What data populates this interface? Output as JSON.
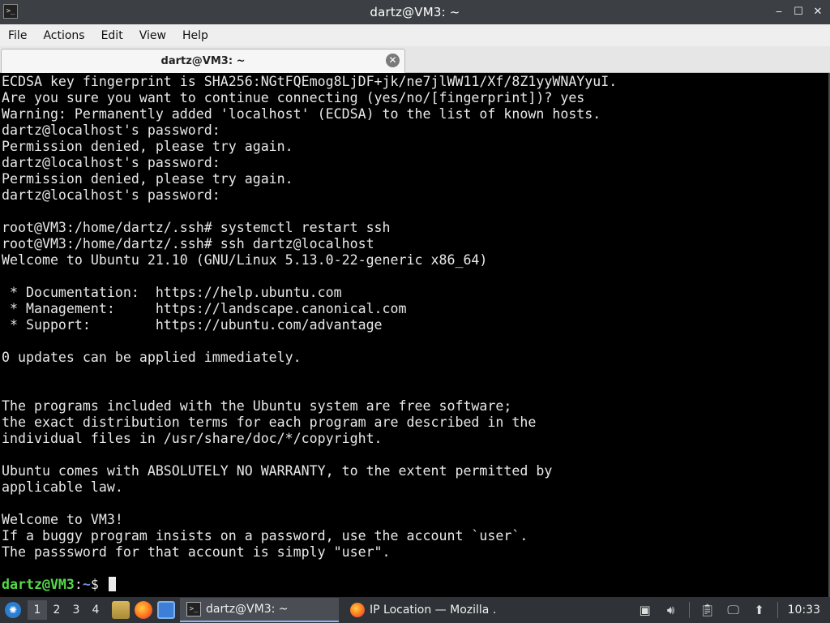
{
  "window": {
    "title": "dartz@VM3: ~",
    "app_icon": "terminal-icon",
    "buttons": [
      "minimize-icon",
      "maximize-icon",
      "close-icon"
    ]
  },
  "menubar": {
    "items": [
      "File",
      "Actions",
      "Edit",
      "View",
      "Help"
    ]
  },
  "tab": {
    "label": "dartz@VM3: ~",
    "close_icon": "tab-close-icon"
  },
  "terminal": {
    "lines": [
      "ECDSA key fingerprint is SHA256:NGtFQEmog8LjDF+jk/ne7jlWW11/Xf/8Z1yyWNAYyuI.",
      "Are you sure you want to continue connecting (yes/no/[fingerprint])? yes",
      "Warning: Permanently added 'localhost' (ECDSA) to the list of known hosts.",
      "dartz@localhost's password:",
      "Permission denied, please try again.",
      "dartz@localhost's password:",
      "Permission denied, please try again.",
      "dartz@localhost's password:",
      "",
      "root@VM3:/home/dartz/.ssh# systemctl restart ssh",
      "root@VM3:/home/dartz/.ssh# ssh dartz@localhost",
      "Welcome to Ubuntu 21.10 (GNU/Linux 5.13.0-22-generic x86_64)",
      "",
      " * Documentation:  https://help.ubuntu.com",
      " * Management:     https://landscape.canonical.com",
      " * Support:        https://ubuntu.com/advantage",
      "",
      "0 updates can be applied immediately.",
      "",
      "",
      "The programs included with the Ubuntu system are free software;",
      "the exact distribution terms for each program are described in the",
      "individual files in /usr/share/doc/*/copyright.",
      "",
      "Ubuntu comes with ABSOLUTELY NO WARRANTY, to the extent permitted by",
      "applicable law.",
      "",
      "Welcome to VM3!",
      "If a buggy program insists on a password, use the account `user`.",
      "The passsword for that account is simply \"user\".",
      ""
    ],
    "prompt": {
      "user_host": "dartz@VM3",
      "separator": ":",
      "path": "~",
      "symbol": "$ "
    }
  },
  "taskbar": {
    "start_icon": "start-menu-icon",
    "workspaces": [
      "1",
      "2",
      "3",
      "4"
    ],
    "active_workspace": "1",
    "quick_launch": [
      "file-manager-icon",
      "firefox-icon",
      "show-desktop-icon"
    ],
    "tasks": [
      {
        "label": "dartz@VM3: ~",
        "icon": "terminal-icon",
        "active": true
      },
      {
        "label": "IP Location — Mozilla ...",
        "icon": "firefox-icon",
        "active": false
      }
    ],
    "tray": [
      "network-icon",
      "volume-icon",
      "clipboard-icon",
      "display-icon",
      "update-icon"
    ],
    "clock": "10:33"
  }
}
